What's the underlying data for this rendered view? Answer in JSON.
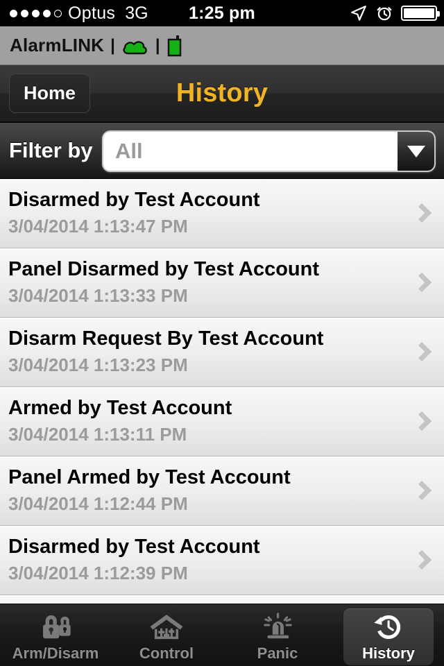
{
  "status_bar": {
    "signal_dots_total": 5,
    "signal_dots_filled": 4,
    "carrier": "Optus",
    "network": "3G",
    "time": "1:25 pm",
    "icons": [
      "location-arrow-icon",
      "alarm-clock-icon",
      "battery-icon"
    ],
    "battery_level_percent": 100
  },
  "brand_bar": {
    "app_name": "AlarmLINK",
    "separator": "|",
    "cloud_status_icon": "cloud-icon",
    "cloud_status_color": "#14b214",
    "device_status_icon": "radio-device-icon",
    "device_status_color": "#14b214",
    "background_color": "#a0a0a0"
  },
  "nav_bar": {
    "back_label": "Home",
    "title": "History",
    "title_color": "#f0b323"
  },
  "filter_bar": {
    "label": "Filter by",
    "selected_value": "All",
    "dropdown_icon": "chevron-down-icon",
    "options": [
      "All"
    ]
  },
  "history": {
    "rows": [
      {
        "title": "Disarmed by Test Account",
        "timestamp": "3/04/2014 1:13:47 PM"
      },
      {
        "title": "Panel Disarmed by Test Account",
        "timestamp": "3/04/2014 1:13:33 PM"
      },
      {
        "title": "Disarm Request By Test Account",
        "timestamp": "3/04/2014 1:13:23 PM"
      },
      {
        "title": "Armed by Test Account",
        "timestamp": "3/04/2014 1:13:11 PM"
      },
      {
        "title": "Panel Armed by Test Account",
        "timestamp": "3/04/2014 1:12:44 PM"
      },
      {
        "title": "Disarmed by Test Account",
        "timestamp": "3/04/2014 1:12:39 PM"
      }
    ],
    "disclosure_icon": "chevron-right-icon"
  },
  "tab_bar": {
    "selected_index": 3,
    "tabs": [
      {
        "label": "Arm/Disarm",
        "icon": "padlock-pair-icon"
      },
      {
        "label": "Control",
        "icon": "house-sliders-icon"
      },
      {
        "label": "Panic",
        "icon": "siren-icon"
      },
      {
        "label": "History",
        "icon": "clock-history-icon"
      }
    ]
  }
}
